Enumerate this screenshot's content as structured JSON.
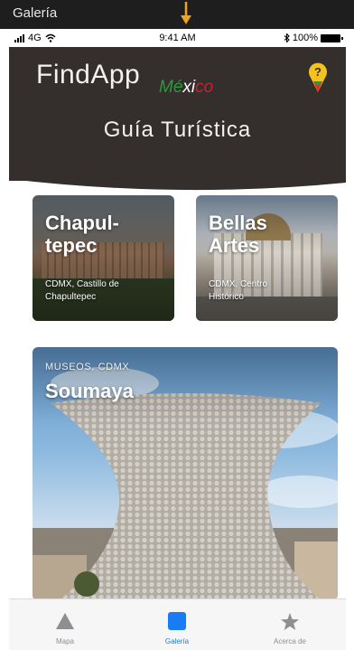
{
  "gallery": {
    "title": "Galería"
  },
  "status_bar": {
    "network": "4G",
    "time": "9:41 AM",
    "battery": "100%"
  },
  "header": {
    "app_name": "FindApp",
    "country_part1": "Mé",
    "country_part2": "xi",
    "country_part3": "co",
    "subtitle": "Guía Turística",
    "colors": {
      "background": "#342e2c",
      "green": "#2a9a3a",
      "white": "#ffffff",
      "red": "#c8232b"
    }
  },
  "cards": [
    {
      "title": "Chapul-\ntepec",
      "caption": "CDMX, Castillo de\nChapultepec"
    },
    {
      "title": "Bellas\nArtes",
      "caption": "CDMX, Centro\nHistórico"
    },
    {
      "kicker": "MUSEOS, CDMX",
      "title": "Soumaya"
    }
  ],
  "tab_bar": {
    "tabs": [
      {
        "label": "Mapa",
        "icon": "triangle-icon"
      },
      {
        "label": "Galería",
        "icon": "square-icon",
        "active": true
      },
      {
        "label": "Acerca de",
        "icon": "star-icon"
      }
    ],
    "accent_color": "#1a7cf5"
  }
}
